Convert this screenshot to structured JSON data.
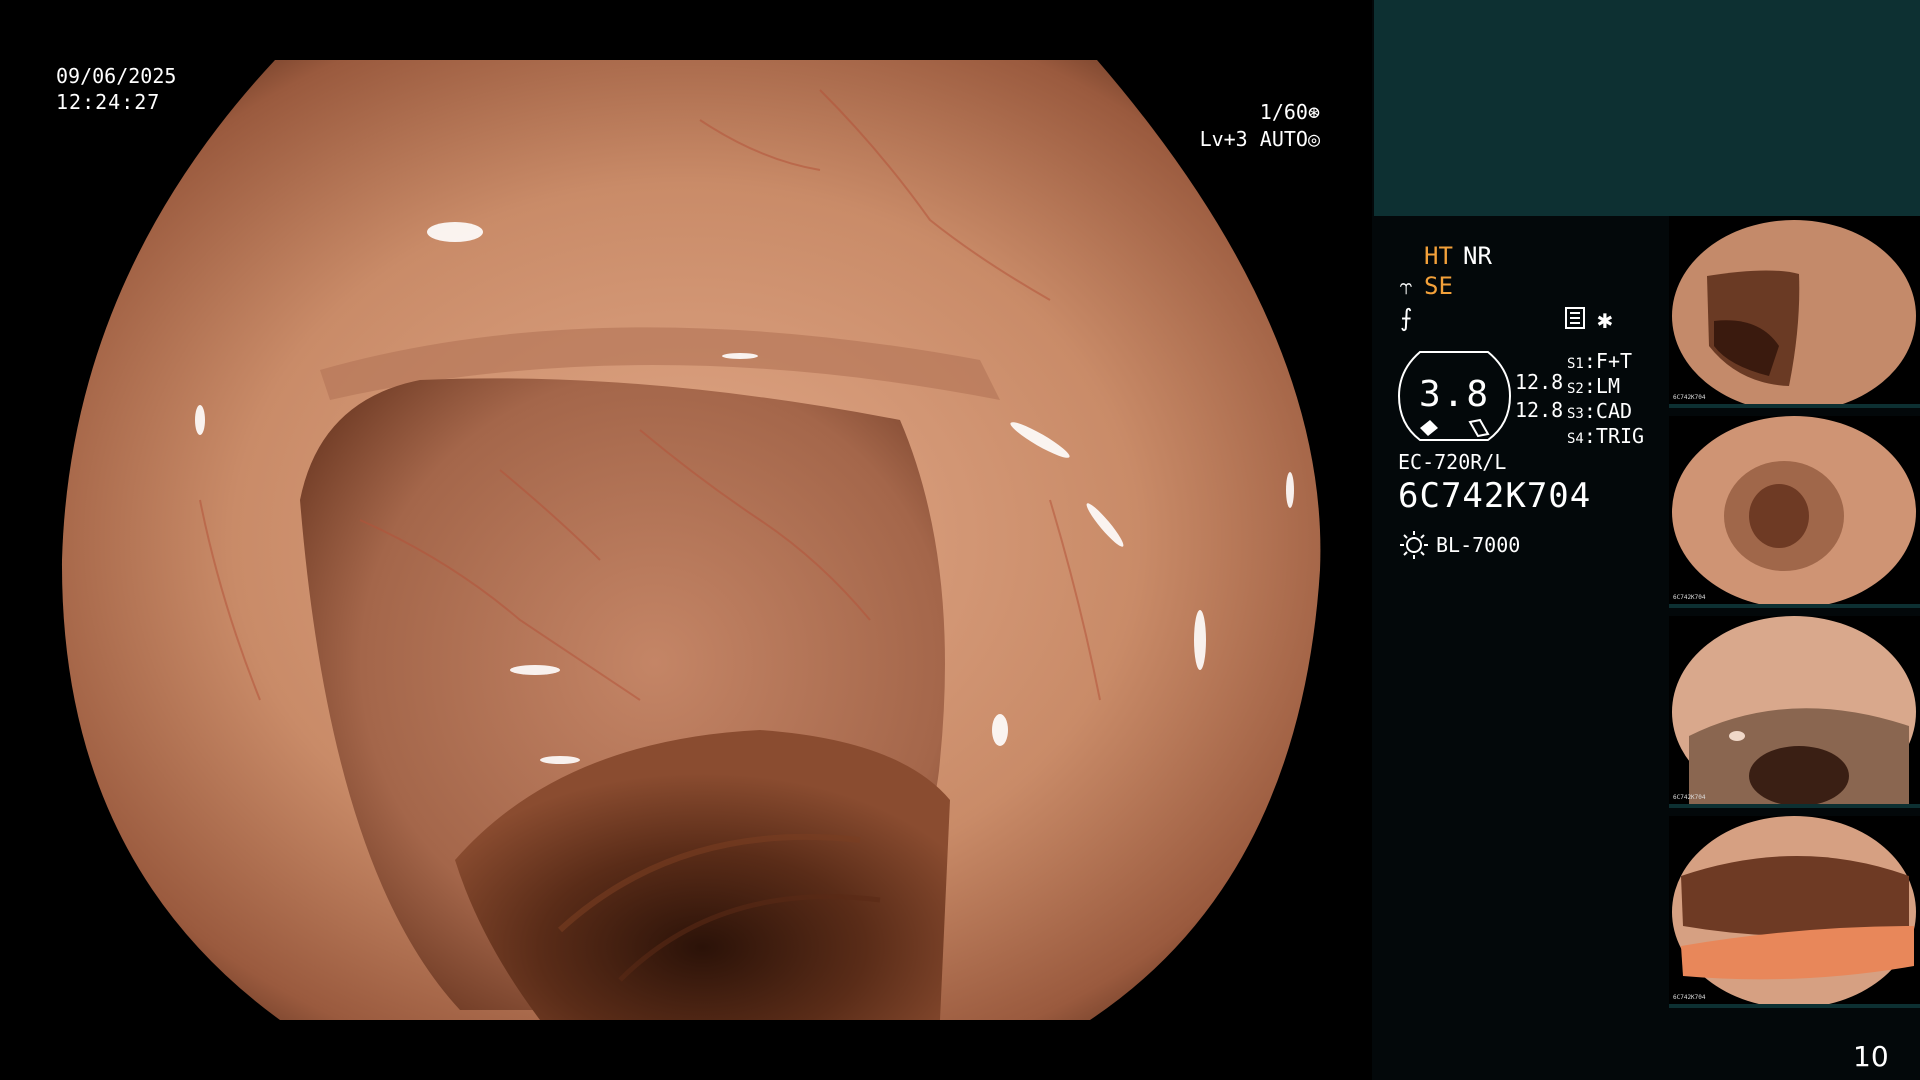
{
  "osd": {
    "date": "09/06/2025",
    "time": "12:24:27",
    "shutter": "1/60",
    "shutter_icon": "aperture-icon",
    "level": "Lv+3",
    "mode": "AUTO",
    "mode_icon": "iris-icon"
  },
  "panel": {
    "ht": "HT",
    "nr": "NR",
    "se": "SE",
    "se_icon": "scope-icon",
    "freeze_icon": "freeze-icon",
    "settings_icon": "settings-icon",
    "star": "✱",
    "gauge_value": "3.8",
    "value_a": "12.8",
    "value_b": "12.8",
    "switches": [
      {
        "key": "S1",
        "value": "F+T"
      },
      {
        "key": "S2",
        "value": "LM"
      },
      {
        "key": "S3",
        "value": "CAD"
      },
      {
        "key": "S4",
        "value": "TRIG"
      }
    ],
    "scope_model": "EC-720R/L",
    "scope_serial": "6C742K704",
    "light_icon": "light-source-icon",
    "light_model": "BL-7000",
    "thumb_caption": "6C742K704",
    "page_number": "10"
  },
  "colors": {
    "panel_top": "#0d3032",
    "panel_bg": "#03080a",
    "accent_orange": "#f3a13a",
    "mucosa": "#c98b68"
  }
}
